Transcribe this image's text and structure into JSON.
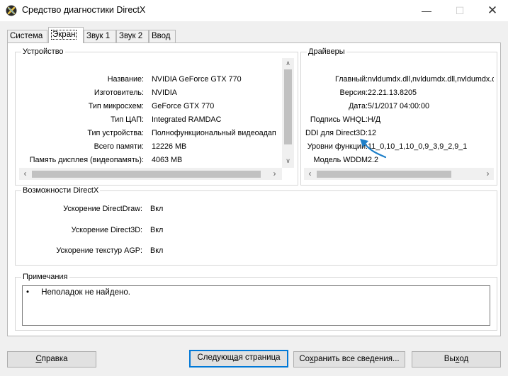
{
  "window": {
    "title": "Средство диагностики DirectX",
    "min_glyph": "—",
    "max_glyph": "☐",
    "close_glyph": "✕"
  },
  "tabs": [
    {
      "label": "Система",
      "active": false
    },
    {
      "label": "Экран",
      "active": true
    },
    {
      "label": "Звук 1",
      "active": false
    },
    {
      "label": "Звук 2",
      "active": false
    },
    {
      "label": "Ввод",
      "active": false
    }
  ],
  "device": {
    "legend": "Устройство",
    "rows": [
      {
        "key": "Название:",
        "value": "NVIDIA GeForce GTX 770"
      },
      {
        "key": "Изготовитель:",
        "value": "NVIDIA"
      },
      {
        "key": "Тип микросхем:",
        "value": "GeForce GTX 770"
      },
      {
        "key": "Тип ЦАП:",
        "value": "Integrated RAMDAC"
      },
      {
        "key": "Тип устройства:",
        "value": "Полнофункциональный видеоадап"
      },
      {
        "key": "Всего памяти:",
        "value": "12226 MB"
      },
      {
        "key": "Память дисплея (видеопамять):",
        "value": "4063 MB"
      }
    ]
  },
  "drivers": {
    "legend": "Драйверы",
    "rows": [
      {
        "key": "Главный:",
        "value": "nvldumdx.dll,nvldumdx.dll,nvldumdx.dl"
      },
      {
        "key": "Версия:",
        "value": "22.21.13.8205"
      },
      {
        "key": "Дата:",
        "value": "5/1/2017 04:00:00"
      },
      {
        "key": "Подпись WHQL:",
        "value": "Н/Д"
      },
      {
        "key": "DDI для Direct3D:",
        "value": "12"
      },
      {
        "key": "Уровни функций:",
        "value": "11_0,10_1,10_0,9_3,9_2,9_1"
      },
      {
        "key": "Модель WDDM",
        "value": "2.2"
      }
    ]
  },
  "directx": {
    "legend": "Возможности DirectX",
    "rows": [
      {
        "key": "Ускорение DirectDraw:",
        "value": "Вкл"
      },
      {
        "key": "Ускорение Direct3D:",
        "value": "Вкл"
      },
      {
        "key": "Ускорение текстур AGP:",
        "value": "Вкл"
      }
    ]
  },
  "notes": {
    "legend": "Примечания",
    "items": [
      "Неполадок не найдено."
    ]
  },
  "buttons": {
    "help_first": "С",
    "help_rest": "правка",
    "next_first": "Следующ",
    "next_ul": "а",
    "next_rest": "я страница",
    "save_first": "Со",
    "save_ul": "х",
    "save_rest": "ранить все сведения...",
    "exit_first": "Вы",
    "exit_ul": "х",
    "exit_rest": "од"
  },
  "colors": {
    "accent": "#0078d7",
    "annotation_arrow": "#1e7fc8"
  }
}
